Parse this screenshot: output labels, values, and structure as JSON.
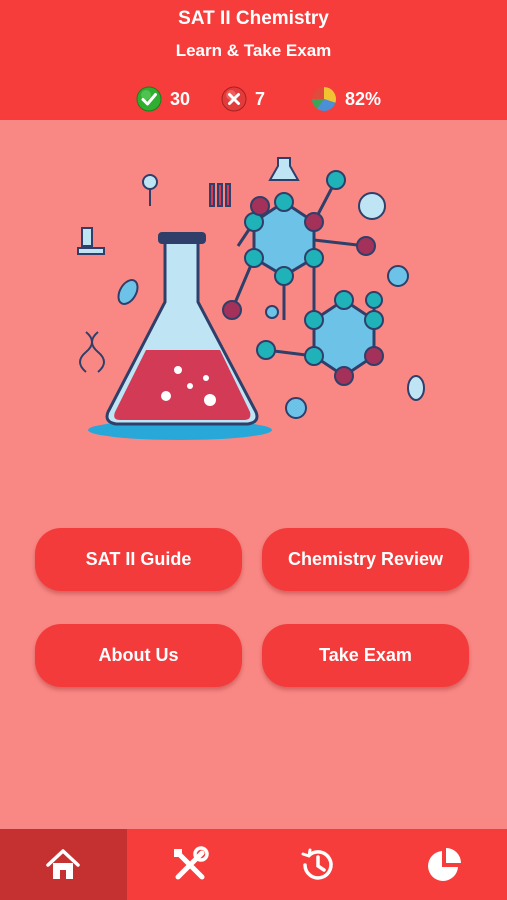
{
  "header": {
    "title": "SAT II Chemistry",
    "subtitle": "Learn & Take Exam"
  },
  "stats": {
    "correct": "30",
    "wrong": "7",
    "score": "82%"
  },
  "buttons": {
    "guide": "SAT II Guide",
    "review": "Chemistry Review",
    "about": "About Us",
    "exam": "Take Exam"
  },
  "tabs": [
    {
      "icon": "home-icon",
      "active": true
    },
    {
      "icon": "tools-icon",
      "active": false
    },
    {
      "icon": "history-icon",
      "active": false
    },
    {
      "icon": "pie-chart-icon",
      "active": false
    }
  ],
  "colors": {
    "header": "#f73c3c",
    "background": "#f98885",
    "button": "#f43b3b",
    "active_tab": "#c53131"
  }
}
